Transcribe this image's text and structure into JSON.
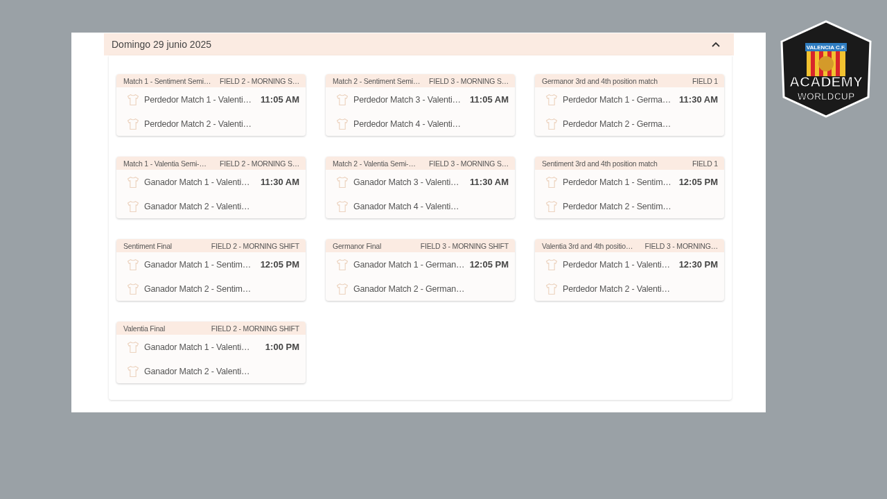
{
  "logo": {
    "club": "VALENCIA C.F.",
    "line_1": "ACADEMY",
    "line_2": "WORLDCUP"
  },
  "day": {
    "title": "Domingo 29 junio 2025",
    "expanded": true,
    "matches": [
      {
        "name": "Match 1 - Sentiment Semi…",
        "field": "FIELD 2 - MORNING S…",
        "home": "Perdedor Match 1 - Valenti…",
        "away": "Perdedor Match 2 - Valenti…",
        "time": "11:05 AM"
      },
      {
        "name": "Match 2 - Sentiment Semi…",
        "field": "FIELD 3 - MORNING S…",
        "home": "Perdedor Match 3 - Valenti…",
        "away": "Perdedor Match 4 - Valenti…",
        "time": "11:05 AM"
      },
      {
        "name": "Germanor 3rd and 4th position match",
        "field": "FIELD 1",
        "home": "Perdedor Match 1 - Germa…",
        "away": "Perdedor Match 2 - Germa…",
        "time": "11:30 AM"
      },
      {
        "name": "Match 1 - Valentia Semi-…",
        "field": "FIELD 2 - MORNING S…",
        "home": "Ganador Match 1 - Valenti…",
        "away": "Ganador Match 2 - Valenti…",
        "time": "11:30 AM"
      },
      {
        "name": "Match 2 - Valentia Semi-…",
        "field": "FIELD 3 - MORNING S…",
        "home": "Ganador Match 3 - Valenti…",
        "away": "Ganador Match 4 - Valenti…",
        "time": "11:30 AM"
      },
      {
        "name": "Sentiment 3rd and 4th position match",
        "field": "FIELD 1",
        "home": "Perdedor Match 1 - Sentim…",
        "away": "Perdedor Match 2 - Sentim…",
        "time": "12:05 PM"
      },
      {
        "name": "Sentiment Final",
        "field": "FIELD 2 - MORNING SHIFT",
        "home": "Ganador Match 1 - Sentim…",
        "away": "Ganador Match 2 - Sentim…",
        "time": "12:05 PM"
      },
      {
        "name": "Germanor Final",
        "field": "FIELD 3 - MORNING SHIFT",
        "home": "Ganador Match 1 - German…",
        "away": "Ganador Match 2 - German…",
        "time": "12:05 PM"
      },
      {
        "name": "Valentia 3rd and 4th positio…",
        "field": "FIELD 3 - MORNING…",
        "home": "Perdedor Match 1 - Valenti…",
        "away": "Perdedor Match 2 - Valenti…",
        "time": "12:30 PM"
      },
      {
        "name": "Valentia Final",
        "field": "FIELD 2 - MORNING SHIFT",
        "home": "Ganador Match 1 - Valenti…",
        "away": "Ganador Match 2 - Valenti…",
        "time": "1:00 PM"
      }
    ]
  }
}
